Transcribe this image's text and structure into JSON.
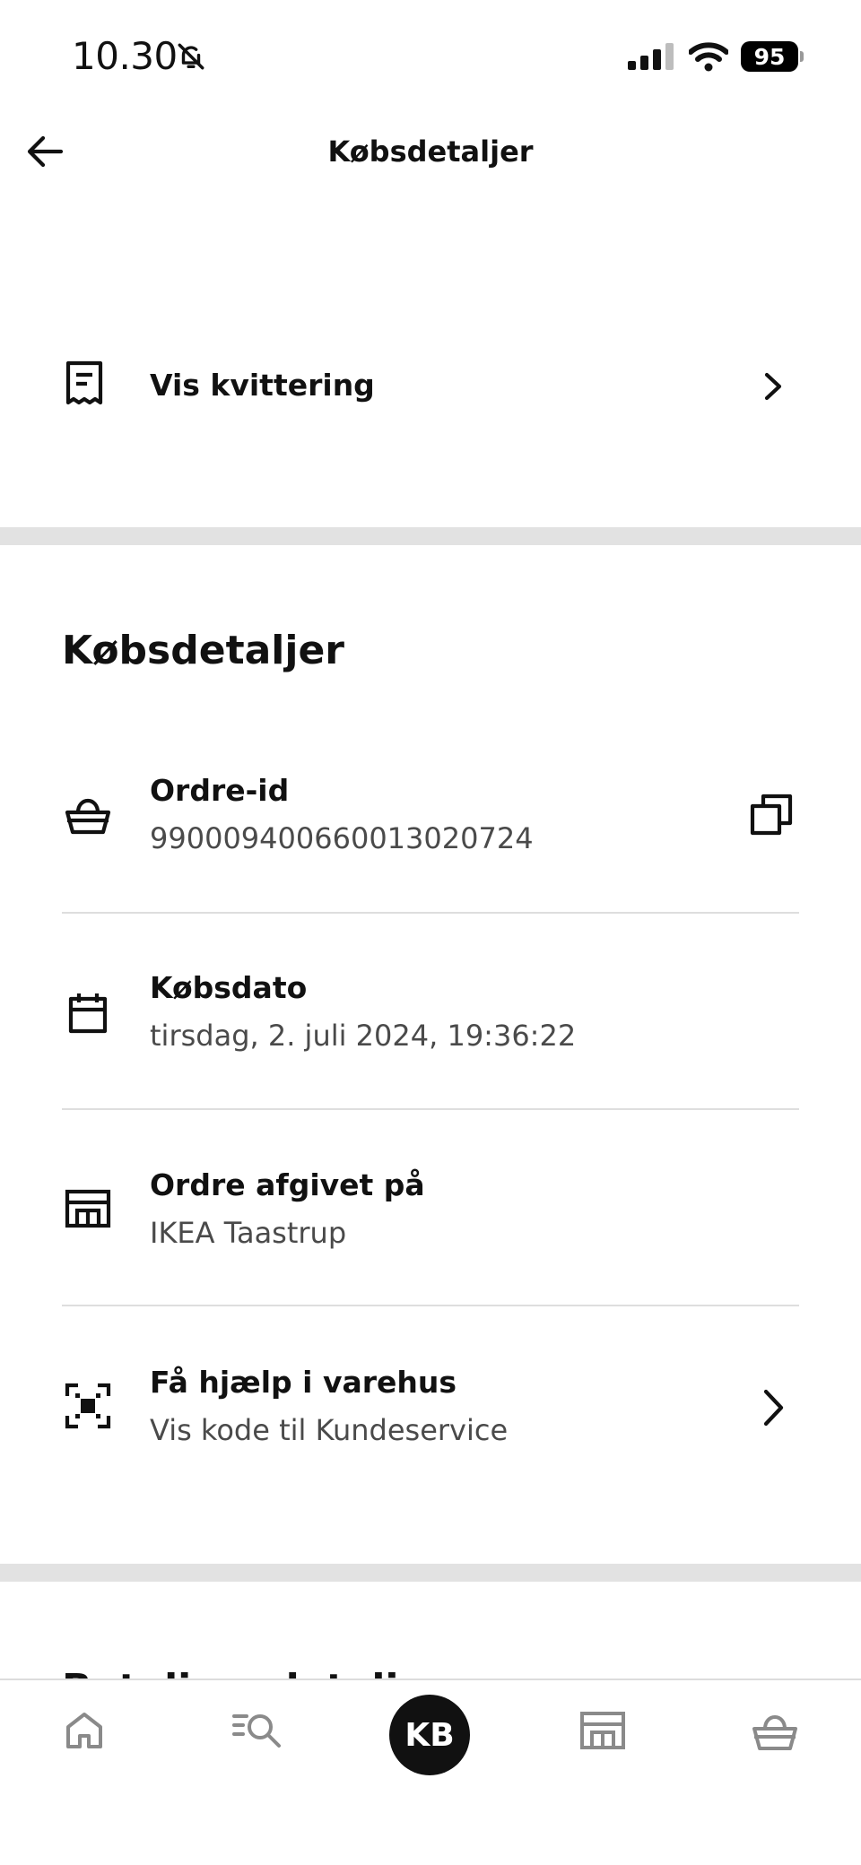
{
  "status_bar": {
    "time": "10.30",
    "battery": "95"
  },
  "header": {
    "title": "Købsdetaljer"
  },
  "receipt": {
    "label": "Vis kvittering"
  },
  "details": {
    "title": "Købsdetaljer",
    "order_id": {
      "label": "Ordre-id",
      "value": "990009400660013020724"
    },
    "purchase_date": {
      "label": "Købsdato",
      "value": "tirsdag, 2. juli 2024, 19:36:22"
    },
    "placed_at": {
      "label": "Ordre afgivet på",
      "value": "IKEA Taastrup"
    },
    "help": {
      "label": "Få hjælp i varehus",
      "value": "Vis kode til Kundeservice"
    }
  },
  "next_section": {
    "title": "Betalingsdetaljer"
  },
  "bottom_nav": {
    "items": [
      {
        "icon": "home-icon"
      },
      {
        "icon": "search-icon"
      },
      {
        "label": "KB"
      },
      {
        "icon": "store-icon"
      },
      {
        "icon": "basket-icon"
      }
    ]
  }
}
